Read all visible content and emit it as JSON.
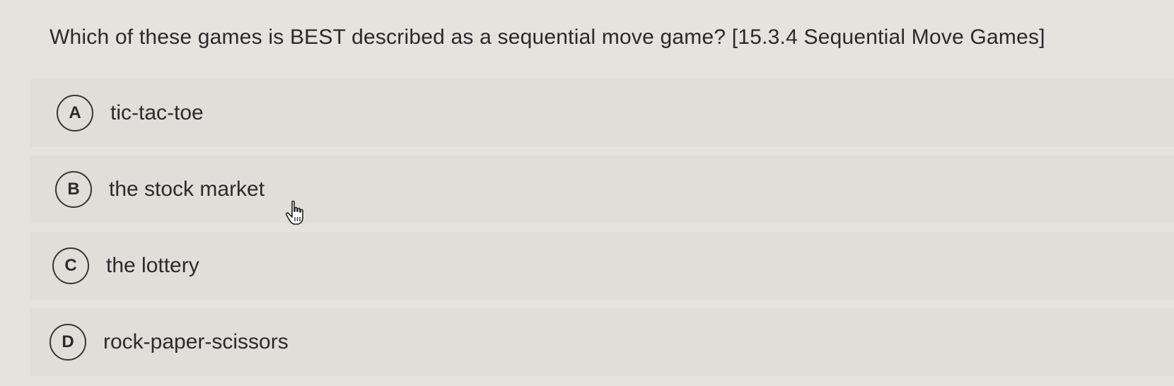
{
  "question": {
    "text": "Which of these games is BEST described as a sequential move game? [15.3.4 Sequential Move Games]"
  },
  "options": [
    {
      "letter": "A",
      "text": "tic-tac-toe"
    },
    {
      "letter": "B",
      "text": "the stock market"
    },
    {
      "letter": "C",
      "text": "the lottery"
    },
    {
      "letter": "D",
      "text": "rock-paper-scissors"
    }
  ],
  "colors": {
    "background": "#e4e3de",
    "option_background": "#dfded9",
    "text": "#2b2b2b",
    "badge_border": "#3a3535"
  },
  "icons": {
    "cursor": "hand-pointer-icon"
  }
}
